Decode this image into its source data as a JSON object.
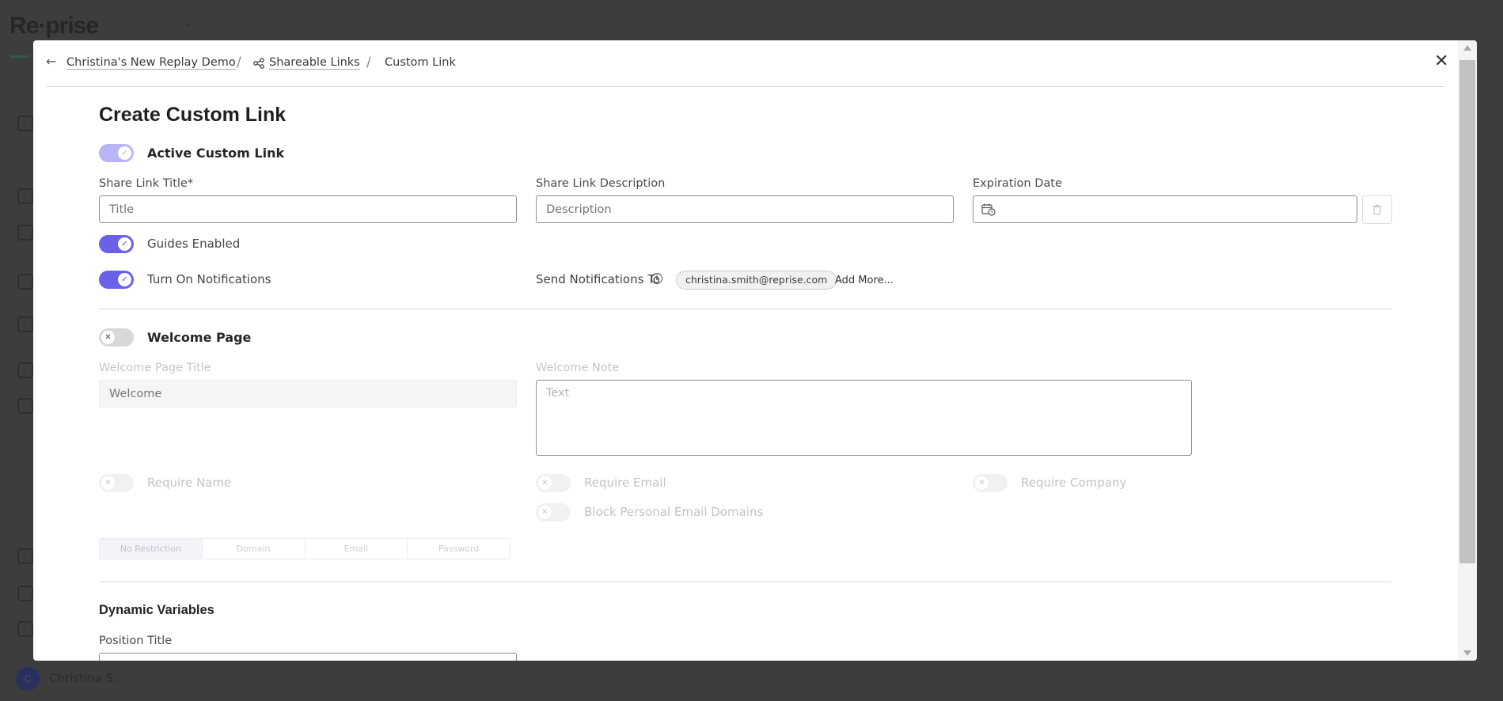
{
  "background": {
    "logo_text": "Re·prise",
    "user_name": "Christina S.",
    "avatar_initial": "C"
  },
  "breadcrumb": {
    "demo": "Christina's New Replay Demo",
    "shareable": "Shareable Links",
    "current": "Custom Link",
    "separator": "/"
  },
  "form": {
    "title": "Create Custom Link",
    "active_label": "Active Custom Link",
    "share_title_label": "Share Link Title*",
    "share_title_placeholder": "Title",
    "share_desc_label": "Share Link Description",
    "share_desc_placeholder": "Description",
    "expiration_label": "Expiration Date",
    "expiration_value": "",
    "guides_label": "Guides Enabled",
    "notifications_label": "Turn On Notifications",
    "send_to_label": "Send Notifications To",
    "recipient": "christina.smith@reprise.com",
    "add_more": "Add More...",
    "welcome_label": "Welcome Page",
    "welcome_title_label": "Welcome Page Title",
    "welcome_title_placeholder": "Welcome",
    "welcome_note_label": "Welcome Note",
    "welcome_note_placeholder": "Text",
    "require_name": "Require Name",
    "require_email": "Require Email",
    "require_company": "Require Company",
    "block_domains": "Block Personal Email Domains",
    "restrictions": [
      "No Restriction",
      "Domain",
      "Email",
      "Password"
    ],
    "dynamic_title": "Dynamic Variables",
    "position_title_label": "Position Title"
  },
  "toggles": {
    "active": true,
    "guides": true,
    "notifications": true,
    "welcome": false,
    "require_name": false,
    "require_email": false,
    "require_company": false,
    "block_domains": false
  },
  "colors": {
    "accent": "#6a61ea",
    "overlay": "#3d3d3d"
  }
}
